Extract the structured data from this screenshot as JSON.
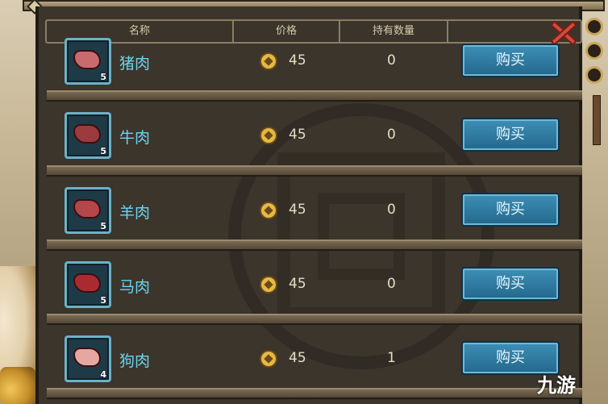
{
  "header": {
    "col_name": "名称",
    "col_price": "价格",
    "col_owned": "持有数量"
  },
  "items": [
    {
      "name": "猪肉",
      "stack": "5",
      "price": "45",
      "owned": "0",
      "buy_label": "购买",
      "meat_color": "#c96a6e"
    },
    {
      "name": "牛肉",
      "stack": "5",
      "price": "45",
      "owned": "0",
      "buy_label": "购买",
      "meat_color": "#9b3a3f"
    },
    {
      "name": "羊肉",
      "stack": "5",
      "price": "45",
      "owned": "0",
      "buy_label": "购买",
      "meat_color": "#b4474c"
    },
    {
      "name": "马肉",
      "stack": "5",
      "price": "45",
      "owned": "0",
      "buy_label": "购买",
      "meat_color": "#a92b30"
    },
    {
      "name": "狗肉",
      "stack": "4",
      "price": "45",
      "owned": "1",
      "buy_label": "购买",
      "meat_color": "#e4a7a2"
    }
  ],
  "watermark": "九游",
  "colors": {
    "item_name": "#6cd4ee",
    "buy_button": "#2f7ca4",
    "close_icon": "#d44a3a",
    "coin": "#e6b945"
  }
}
